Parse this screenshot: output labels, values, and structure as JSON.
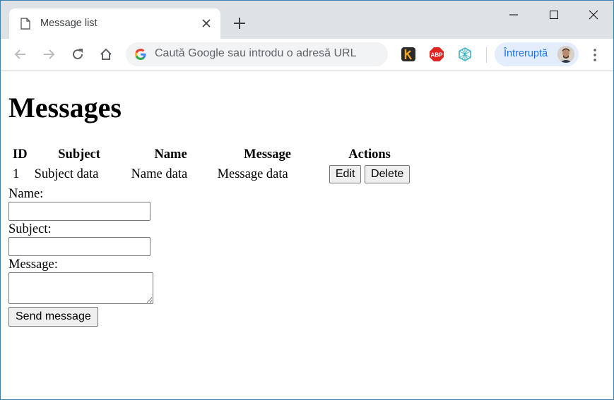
{
  "browser": {
    "tab": {
      "title": "Message list"
    },
    "omnibox": {
      "placeholder": "Caută Google sau introdu o adresă URL"
    },
    "profile": {
      "label": "Întreruptă"
    }
  },
  "page": {
    "heading": "Messages",
    "table": {
      "headers": [
        "ID",
        "Subject",
        "Name",
        "Message",
        "Actions"
      ],
      "rows": [
        {
          "id": "1",
          "subject": "Subject data",
          "name": "Name data",
          "message": "Message data",
          "edit": "Edit",
          "delete": "Delete"
        }
      ]
    },
    "form": {
      "name_label": "Name:",
      "subject_label": "Subject:",
      "message_label": "Message:",
      "name_value": "",
      "subject_value": "",
      "message_value": "",
      "submit": "Send message"
    }
  }
}
